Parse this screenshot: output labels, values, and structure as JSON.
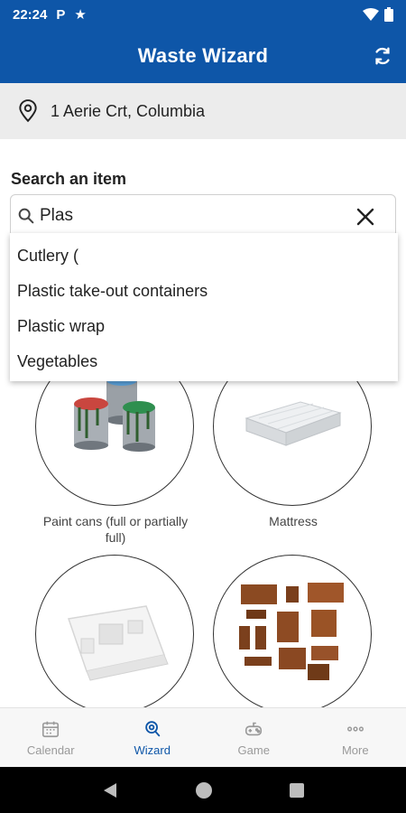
{
  "status_bar": {
    "time": "22:24",
    "notif_p": "P"
  },
  "header": {
    "title": "Waste Wizard"
  },
  "location": {
    "address": "1 Aerie Crt, Columbia"
  },
  "search": {
    "label": "Search an item",
    "value": "Plas"
  },
  "suggestions": [
    "Cutlery (",
    "Plastic take-out containers",
    "Plastic wrap",
    "Vegetables"
  ],
  "items": [
    {
      "label": "Paint cans (full or partially full)",
      "icon": "paint-cans"
    },
    {
      "label": "Mattress",
      "icon": "mattress"
    },
    {
      "label": "",
      "icon": "styrofoam-packaging"
    },
    {
      "label": "",
      "icon": "furniture"
    }
  ],
  "bottom_nav": [
    {
      "label": "Calendar",
      "icon": "calendar-icon",
      "active": false
    },
    {
      "label": "Wizard",
      "icon": "wizard-icon",
      "active": true
    },
    {
      "label": "Game",
      "icon": "game-icon",
      "active": false
    },
    {
      "label": "More",
      "icon": "more-icon",
      "active": false
    }
  ],
  "colors": {
    "primary": "#0e56a8",
    "location_bg": "#ececec",
    "nav_inactive": "#9a9a9a"
  }
}
